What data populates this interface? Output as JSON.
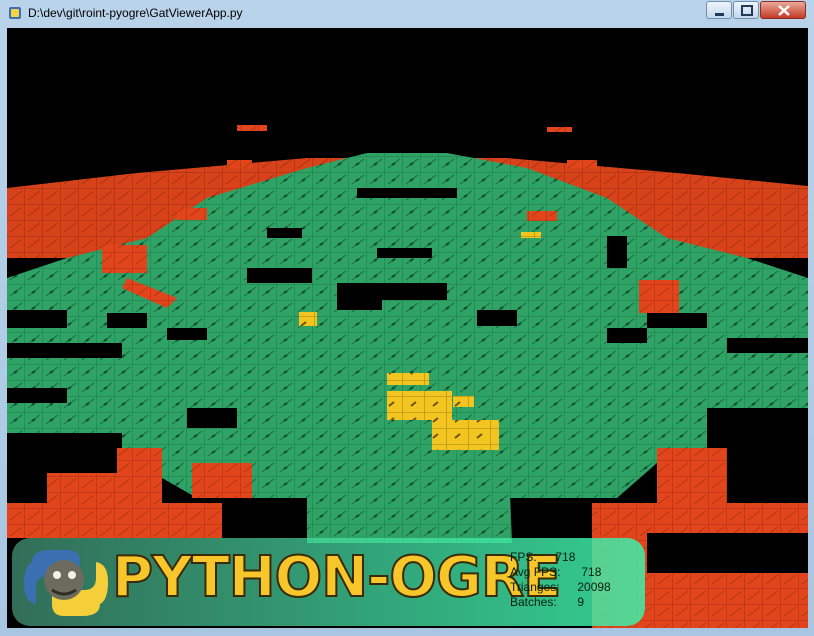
{
  "window": {
    "title": "D:\\dev\\git\\roint-pyogre\\GatViewerApp.py",
    "controls": [
      "minimize",
      "maximize",
      "close"
    ]
  },
  "overlay": {
    "logo_text": "PYTHON-OGRE",
    "stats": [
      {
        "label": "FPS:",
        "value": "718"
      },
      {
        "label": "Avg FPS:",
        "value": "718"
      },
      {
        "label": "Trianges:",
        "value": "20098"
      },
      {
        "label": "Batches:",
        "value": "9"
      }
    ]
  },
  "colors": {
    "walkable": "#2fa265",
    "non_walkable": "#e2451c",
    "water": "#f3c521",
    "void": "#000000"
  }
}
